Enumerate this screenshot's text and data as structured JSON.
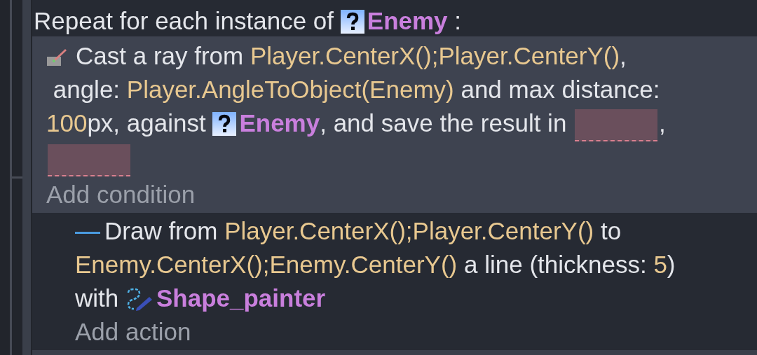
{
  "loop": {
    "segments": [
      {
        "kind": "text",
        "text": "Repeat for each instance of "
      },
      {
        "kind": "object",
        "text": "Enemy"
      },
      {
        "kind": "text",
        "text": " :"
      }
    ]
  },
  "condition": {
    "segments": [
      {
        "kind": "text",
        "text": "Cast a ray from "
      },
      {
        "kind": "param",
        "text": "Player.CenterX();Player.CenterY()"
      },
      {
        "kind": "text",
        "text": ","
      },
      {
        "kind": "text",
        "text": " angle: "
      },
      {
        "kind": "param",
        "text": "Player.AngleToObject(Enemy)"
      },
      {
        "kind": "text",
        "text": " and max distance: "
      },
      {
        "kind": "param",
        "text": "100"
      },
      {
        "kind": "text",
        "text": "px, against "
      },
      {
        "kind": "object",
        "text": "Enemy"
      },
      {
        "kind": "text",
        "text": ", and save the result in "
      },
      {
        "kind": "field"
      },
      {
        "kind": "text",
        "text": ","
      },
      {
        "kind": "field"
      }
    ]
  },
  "add_condition": "Add condition",
  "action": {
    "segments": [
      {
        "kind": "text",
        "text": "Draw from "
      },
      {
        "kind": "param",
        "text": "Player.CenterX();Player.CenterY()"
      },
      {
        "kind": "text",
        "text": " to "
      },
      {
        "kind": "param",
        "text": "Enemy.CenterX();Enemy.CenterY()"
      },
      {
        "kind": "text",
        "text": " a line (thickness: "
      },
      {
        "kind": "param",
        "text": "5"
      },
      {
        "kind": "text",
        "text": ")"
      },
      {
        "kind": "text",
        "text": "with "
      },
      {
        "kind": "object",
        "text": "Shape_painter"
      }
    ]
  },
  "add_action": "Add action"
}
